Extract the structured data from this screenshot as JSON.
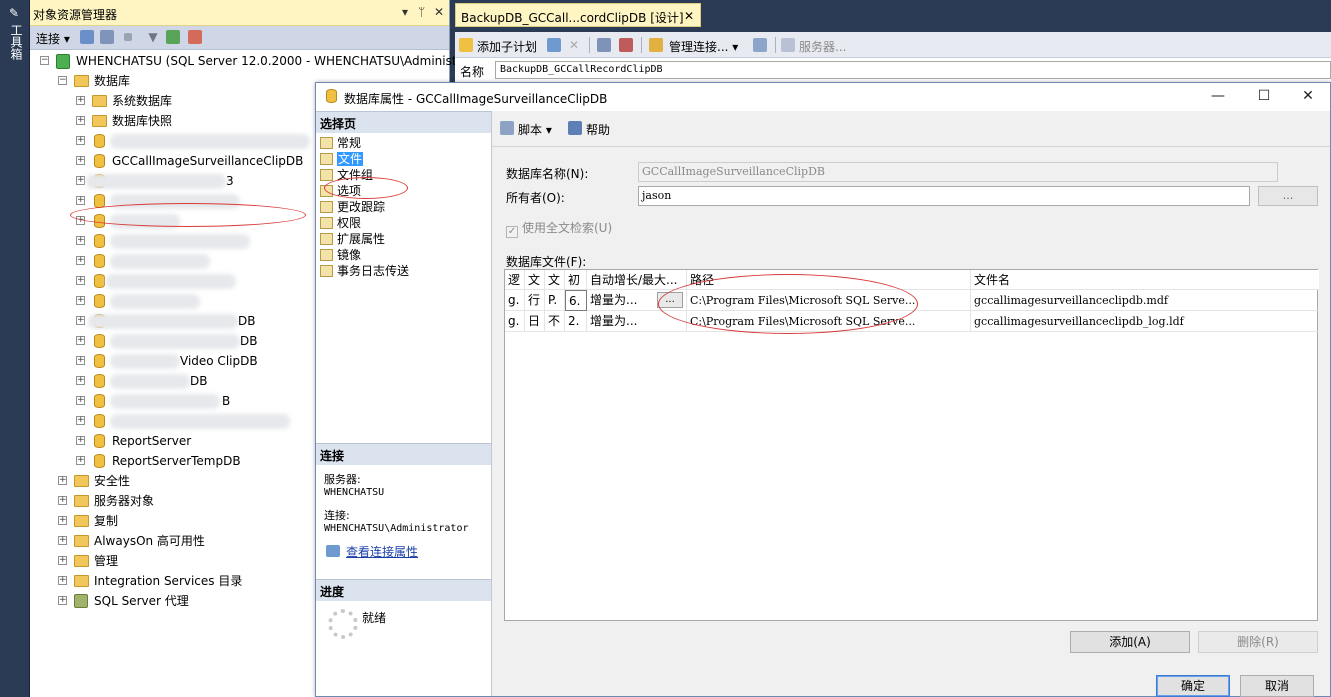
{
  "toolbox": {
    "label": "工具箱"
  },
  "object_explorer": {
    "title": "对象资源管理器",
    "toolbar": {
      "connect_label": "连接"
    },
    "tree": {
      "server": "WHENCHATSU (SQL Server 12.0.2000 - WHENCHATSU\\Administrator)",
      "databases_label": "数据库",
      "system_databases": "系统数据库",
      "db_snapshots": "数据库快照",
      "selected_db": "GCCallImageSurveillanceClipDB",
      "partial_labels": [
        "DB",
        "DB",
        "Video ClipDB",
        "DB",
        "B",
        "3"
      ],
      "report_server": "ReportServer",
      "report_server_temp": "ReportServerTempDB",
      "security": "安全性",
      "server_objects": "服务器对象",
      "replication": "复制",
      "alwayson": "AlwaysOn 高可用性",
      "management": "管理",
      "integration_services": "Integration Services 目录",
      "sql_agent": "SQL Server 代理"
    }
  },
  "document": {
    "tab_title": "BackupDB_GCCall...cordClipDB [设计]",
    "toolbar": {
      "add_subplan": "添加子计划",
      "manage_connections": "管理连接...",
      "servers": "服务器..."
    },
    "name_label": "名称",
    "name_value": "BackupDB_GCCallRecordClipDB"
  },
  "dialog": {
    "title": "数据库属性 - GCCallImageSurveillanceClipDB",
    "select_page_header": "选择页",
    "pages": [
      "常规",
      "文件",
      "文件组",
      "选项",
      "更改跟踪",
      "权限",
      "扩展属性",
      "镜像",
      "事务日志传送"
    ],
    "selected_page": "文件",
    "connection_header": "连接",
    "server_label": "服务器:",
    "server_value": "WHENCHATSU",
    "connection_label": "连接:",
    "connection_value": "WHENCHATSU\\Administrator",
    "view_connection_link": "查看连接属性",
    "progress_header": "进度",
    "progress_status": "就绪",
    "toolbar": {
      "script": "脚本",
      "help": "帮助"
    },
    "db_name_label": "数据库名称(N):",
    "db_name_value": "GCCallImageSurveillanceClipDB",
    "owner_label": "所有者(O):",
    "owner_value": "jason",
    "owner_browse": "...",
    "fulltext_label": "使用全文检索(U)",
    "db_files_label": "数据库文件(F):",
    "grid": {
      "columns": [
        "逻",
        "文",
        "文",
        "初",
        "自动增长/最大...",
        "路径",
        "文件名"
      ],
      "rows": [
        {
          "logical": "g.",
          "type": "行",
          "filegroup": "P.",
          "initial": "6.",
          "autogrowth": "增量为...",
          "path": "C:\\Program Files\\Microsoft SQL Serve...",
          "filename": "gccallimagesurveillanceclipdb.mdf"
        },
        {
          "logical": "g.",
          "type": "日",
          "filegroup": "不",
          "initial": "2.",
          "autogrowth": "增量为...",
          "path": "C:\\Program Files\\Microsoft SQL Serve...",
          "filename": "gccallimagesurveillanceclipdb_log.ldf"
        }
      ],
      "cell_button": "..."
    },
    "add_button": "添加(A)",
    "delete_button": "删除(R)",
    "ok_button": "确定",
    "cancel_button": "取消"
  },
  "colors": {
    "selection": "#3399ff",
    "annotation_red": "#d93a3a",
    "oe_title_bg": "#fff5c2",
    "section_head_bg": "#dbe3ef"
  }
}
